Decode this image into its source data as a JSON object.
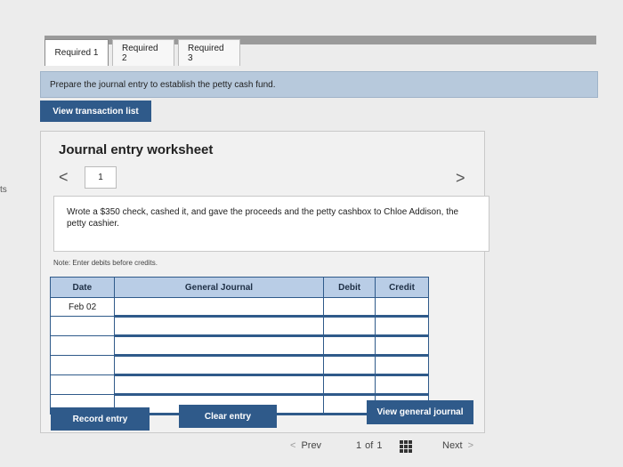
{
  "side_note": "ts",
  "tabs": [
    {
      "label": "Required 1"
    },
    {
      "label": "Required 2"
    },
    {
      "label": "Required 3"
    }
  ],
  "instruction": "Prepare the journal entry to establish the petty cash fund.",
  "buttons": {
    "view_transactions": "View transaction list",
    "record_entry": "Record entry",
    "clear_entry": "Clear entry",
    "view_general_journal": "View general journal"
  },
  "worksheet": {
    "title": "Journal entry worksheet",
    "prev_symbol": "<",
    "next_symbol": ">",
    "entry_number": "1",
    "description": "Wrote a $350 check, cashed it, and gave the proceeds and the petty cashbox to Chloe Addison, the petty cashier.",
    "note": "Note: Enter debits before credits."
  },
  "journal": {
    "headers": {
      "date": "Date",
      "general_journal": "General Journal",
      "debit": "Debit",
      "credit": "Credit"
    },
    "rows": [
      {
        "date": "Feb 02"
      },
      {
        "date": ""
      },
      {
        "date": ""
      },
      {
        "date": ""
      },
      {
        "date": ""
      },
      {
        "date": ""
      }
    ]
  },
  "pagination": {
    "prev": "Prev",
    "current": "1",
    "of": "of",
    "total": "1",
    "next": "Next",
    "prev_arrow": "<",
    "next_arrow": ">"
  },
  "colors": {
    "accent": "#2f5a8a",
    "header_fill": "#b9cde6",
    "instruction_bar": "#b7c9dc"
  }
}
